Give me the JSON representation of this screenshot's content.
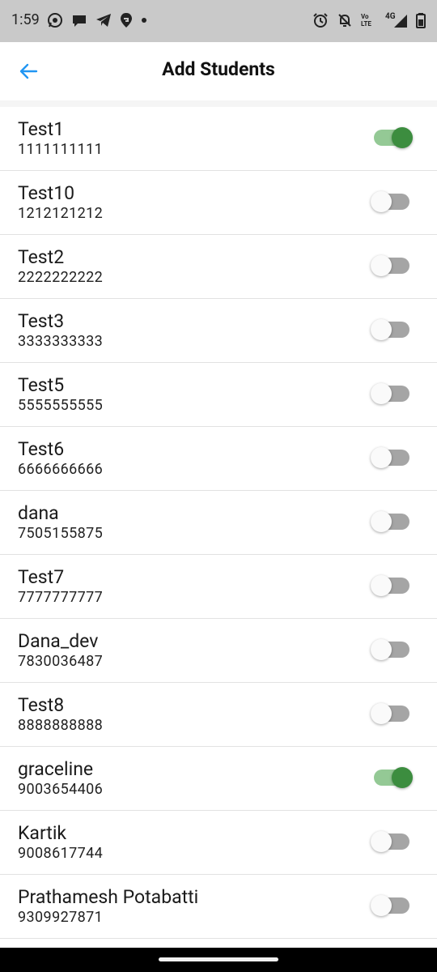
{
  "status": {
    "time": "1:59",
    "left_icons": [
      "whatsapp-icon",
      "chat-icon",
      "telegram-icon",
      "swiggy-icon",
      "dot-icon"
    ],
    "right_icons": [
      "alarm-icon",
      "bell-off-icon",
      "volte-icon",
      "4g-signal-icon",
      "battery-icon"
    ],
    "volte_label": "Vo LTE",
    "network_label": "4G"
  },
  "appbar": {
    "title": "Add Students",
    "back_icon": "arrow-left-icon"
  },
  "colors": {
    "accent_back": "#2196f3",
    "switch_on_thumb": "#3c8d3f",
    "switch_on_track": "#94c995",
    "switch_off_track": "#a5a5a5"
  },
  "students": [
    {
      "name": "Test1",
      "phone": "1111111111",
      "selected": true
    },
    {
      "name": "Test10",
      "phone": "1212121212",
      "selected": false
    },
    {
      "name": "Test2",
      "phone": "2222222222",
      "selected": false
    },
    {
      "name": "Test3",
      "phone": "3333333333",
      "selected": false
    },
    {
      "name": "Test5",
      "phone": "5555555555",
      "selected": false
    },
    {
      "name": "Test6",
      "phone": "6666666666",
      "selected": false
    },
    {
      "name": "dana",
      "phone": "7505155875",
      "selected": false
    },
    {
      "name": "Test7",
      "phone": "7777777777",
      "selected": false
    },
    {
      "name": "Dana_dev",
      "phone": "7830036487",
      "selected": false
    },
    {
      "name": "Test8",
      "phone": "8888888888",
      "selected": false
    },
    {
      "name": "graceline",
      "phone": "9003654406",
      "selected": true
    },
    {
      "name": "Kartik",
      "phone": "9008617744",
      "selected": false
    },
    {
      "name": "Prathamesh Potabatti",
      "phone": "9309927871",
      "selected": false
    }
  ]
}
